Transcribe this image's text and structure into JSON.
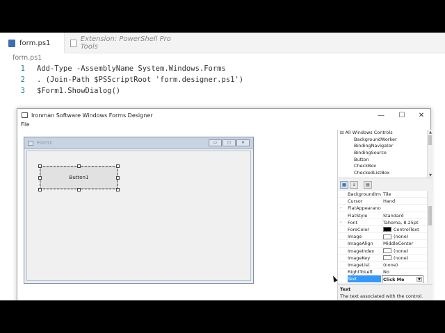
{
  "editor": {
    "tabs": [
      {
        "label": "form.ps1",
        "icon": "powershell-file-icon",
        "active": true
      },
      {
        "label": "Extension: PowerShell Pro Tools",
        "icon": "document-icon",
        "active": false
      }
    ],
    "breadcrumb": "form.ps1",
    "lines": [
      {
        "num": "1",
        "text": "Add-Type -AssemblyName System.Windows.Forms"
      },
      {
        "num": "2",
        "text": ". (Join-Path $PSScriptRoot 'form.designer.ps1')"
      },
      {
        "num": "3",
        "text": "$Form1.ShowDialog()"
      }
    ]
  },
  "designer": {
    "title": "Ironman Software Windows Forms Designer",
    "window_buttons": {
      "minimize": "—",
      "maximize": "☐",
      "close": "✕"
    },
    "menu": [
      "File"
    ],
    "form": {
      "title": "Form1",
      "button_label": "Button1"
    },
    "toolbox": {
      "root": "All Windows Controls",
      "items": [
        "BackgroundWorker",
        "BindingNavigator",
        "BindingSource",
        "Button",
        "CheckBox",
        "CheckedListBox"
      ]
    },
    "properties": [
      {
        "name": "BackgroundIma",
        "value": "Tile",
        "expandable": false
      },
      {
        "name": "Cursor",
        "value": "Hand",
        "expandable": false
      },
      {
        "name": "FlatAppearance",
        "value": "",
        "expandable": true
      },
      {
        "name": "FlatStyle",
        "value": "Standard",
        "expandable": false
      },
      {
        "name": "Font",
        "value": "Tahoma, 8.25pt",
        "expandable": true
      },
      {
        "name": "ForeColor",
        "value": "ControlText",
        "swatch": "#000000",
        "expandable": false
      },
      {
        "name": "Image",
        "value": "(none)",
        "swatch": "#ffffff",
        "expandable": false
      },
      {
        "name": "ImageAlign",
        "value": "MiddleCenter",
        "expandable": false
      },
      {
        "name": "ImageIndex",
        "value": "(none)",
        "swatch": "#ffffff",
        "expandable": false
      },
      {
        "name": "ImageKey",
        "value": "(none)",
        "swatch": "#ffffff",
        "expandable": false
      },
      {
        "name": "ImageList",
        "value": "(none)",
        "expandable": false
      },
      {
        "name": "RightToLeft",
        "value": "No",
        "expandable": false
      },
      {
        "name": "Text",
        "value": "Click Me",
        "expandable": false,
        "selected": true
      }
    ],
    "description": {
      "title": "Text",
      "body": "The text associated with the control."
    }
  }
}
